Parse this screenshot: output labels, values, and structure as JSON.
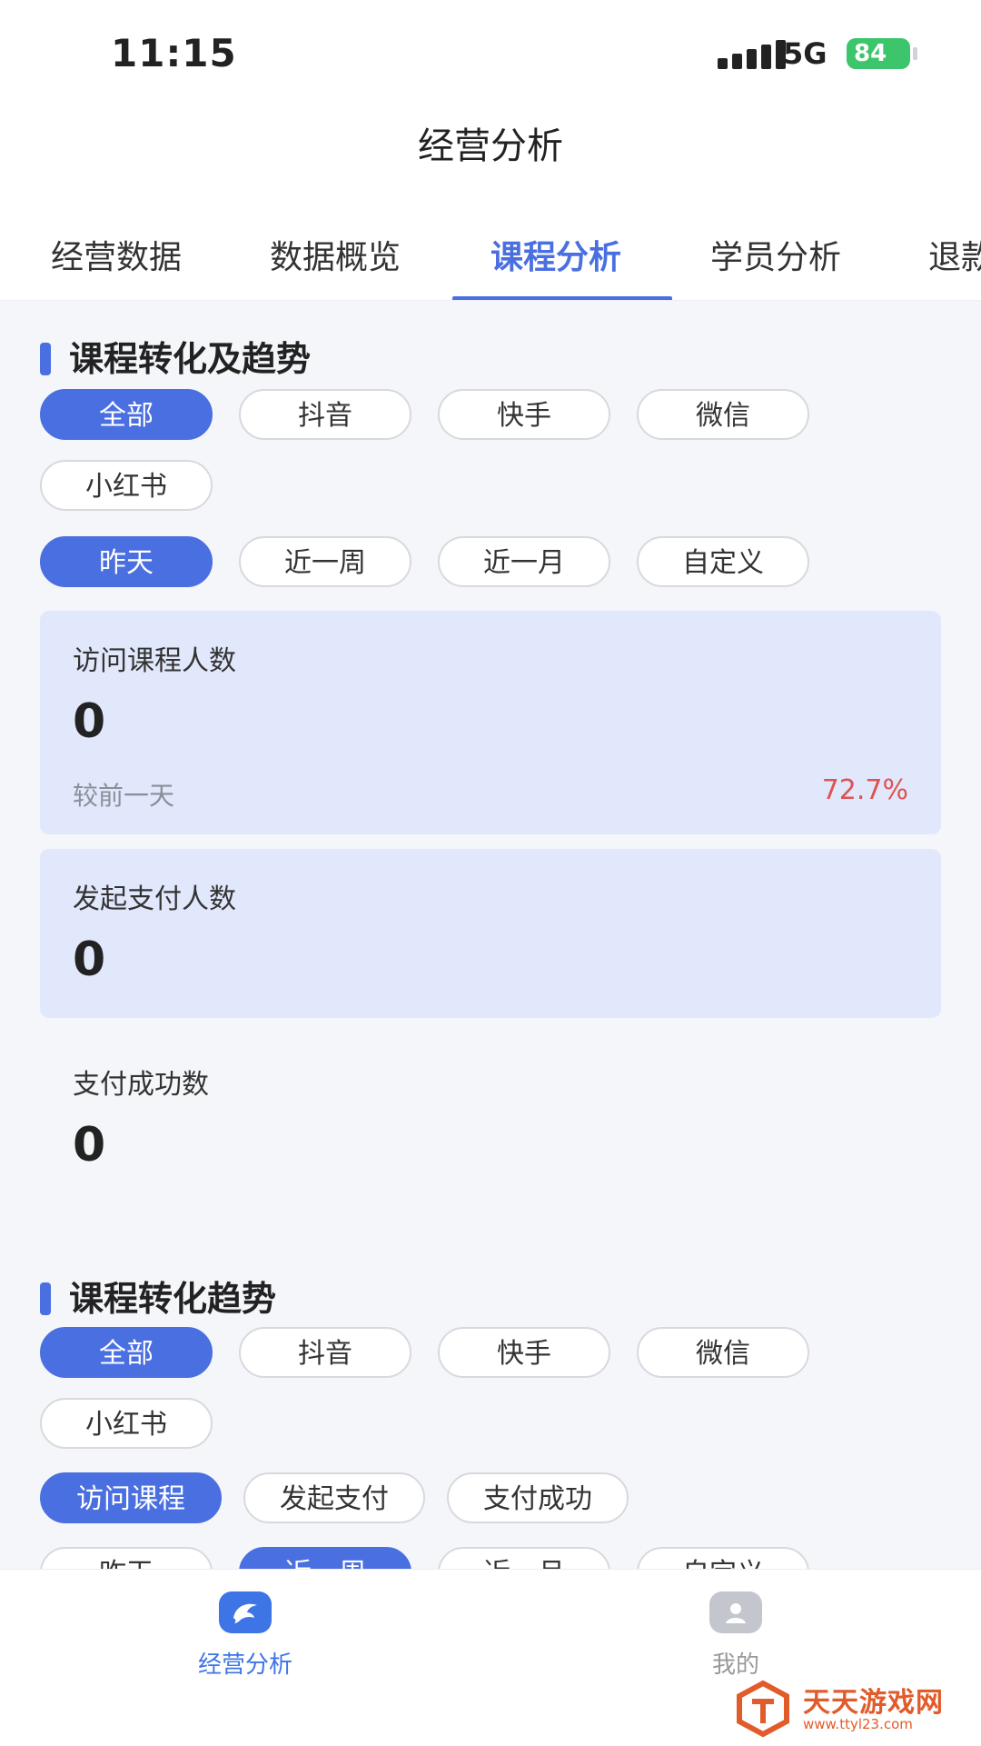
{
  "status": {
    "time": "11:15",
    "network": "5G",
    "battery": "84"
  },
  "header": {
    "title": "经营分析"
  },
  "tabs": [
    {
      "label": "经营数据"
    },
    {
      "label": "数据概览"
    },
    {
      "label": "课程分析",
      "active": true
    },
    {
      "label": "学员分析"
    },
    {
      "label": "退款"
    }
  ],
  "section1": {
    "title": "课程转化及趋势",
    "platforms": [
      "全部",
      "抖音",
      "快手",
      "微信",
      "小红书"
    ],
    "platform_selected": "全部",
    "periods": [
      "昨天",
      "近一周",
      "近一月",
      "自定义"
    ],
    "period_selected": "昨天",
    "cards": [
      {
        "label": "访问课程人数",
        "value": "0",
        "compare": "较前一天",
        "change": "72.7%"
      },
      {
        "label": "发起支付人数",
        "value": "0"
      },
      {
        "label": "支付成功数",
        "value": "0"
      }
    ]
  },
  "section2": {
    "title": "课程转化趋势",
    "platforms": [
      "全部",
      "抖音",
      "快手",
      "微信",
      "小红书"
    ],
    "platform_selected": "全部",
    "metrics": [
      "访问课程",
      "发起支付",
      "支付成功"
    ],
    "metric_selected": "访问课程",
    "periods": [
      "昨天",
      "近一周",
      "近一月",
      "自定义"
    ],
    "period_selected": "近一周"
  },
  "bottom_nav": [
    {
      "label": "经营分析",
      "active": true,
      "icon": "dolphin-icon"
    },
    {
      "label": "我的",
      "active": false,
      "icon": "user-icon"
    }
  ],
  "watermark": {
    "text": "天天游戏网",
    "url": "www.ttyl23.com"
  },
  "colors": {
    "accent": "#4a6fe0",
    "card_bg": "#e1e8fc",
    "negative": "#e05252"
  }
}
